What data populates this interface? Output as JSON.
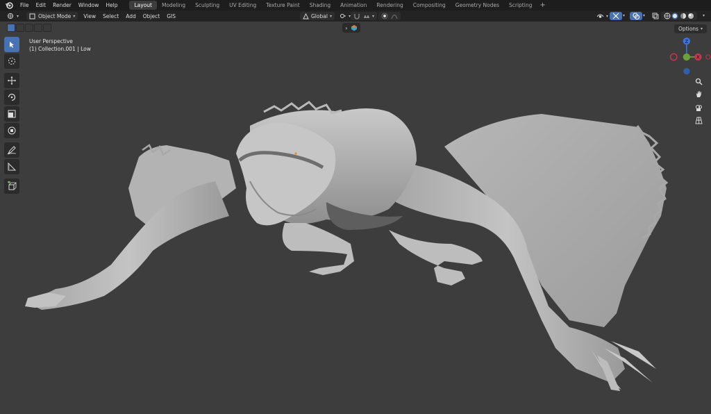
{
  "menu": {
    "items": [
      "File",
      "Edit",
      "Render",
      "Window",
      "Help"
    ]
  },
  "workspaces": {
    "tabs": [
      "Layout",
      "Modeling",
      "Sculpting",
      "UV Editing",
      "Texture Paint",
      "Shading",
      "Animation",
      "Rendering",
      "Compositing",
      "Geometry Nodes",
      "Scripting"
    ],
    "active": "Layout",
    "add": "+"
  },
  "header": {
    "mode": "Object Mode",
    "view": "View",
    "select": "Select",
    "add": "Add",
    "object": "Object",
    "gis": "GIS",
    "orientation": "Global"
  },
  "viewport": {
    "perspective": "User Perspective",
    "collection": "(1) Collection.001 | Low",
    "options": "Options"
  },
  "gizmo": {
    "z": "Z",
    "y": "Y",
    "x": "X"
  },
  "colors": {
    "accent": "#4772b3",
    "x_axis": "#c3384b",
    "y_axis": "#6aa138",
    "z_axis": "#3c77d6",
    "viewport_bg": "#3d3d3d"
  }
}
